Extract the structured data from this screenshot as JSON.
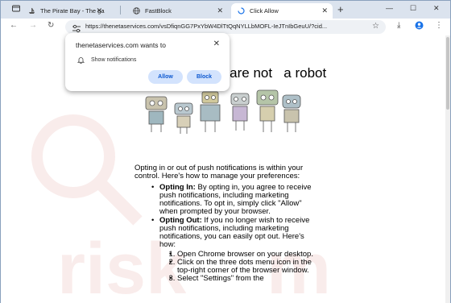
{
  "tabs": [
    {
      "title": "The Pirate Bay - The galaxy's most resilient BitTorrent site",
      "favicon": "pirate-ship-icon"
    },
    {
      "title": "FastBlock",
      "favicon": "globe-icon"
    },
    {
      "title": "Click Allow",
      "favicon": "loading-icon",
      "active": true
    }
  ],
  "toolbar": {
    "url": "https://thenetaservices.com/vsDfiqnGG7PxYbW4DlTtQqNYLLbMOFL-IeJTnIbGeuU/?cid..."
  },
  "popup": {
    "title": "thenetaservices.com wants to",
    "permission": "Show notifications",
    "allow_label": "Allow",
    "block_label": "Block"
  },
  "page": {
    "heading": "u are not   a robot",
    "intro": "Opting in or out of push notifications is within your control. Here's how to manage your preferences:",
    "bullets": [
      {
        "title": "Opting In:",
        "text": " By opting in, you agree to receive push notifications, including marketing notifications. To opt in, simply click \"Allow\" when prompted by your browser."
      },
      {
        "title": "Opting Out:",
        "text": " If you no longer wish to receive push notifications, including marketing notifications, you can easily opt out. Here's how:"
      }
    ],
    "steps": [
      "Open Chrome browser on your desktop.",
      "Click on the three dots menu icon in the top-right corner of the browser window.",
      "Select \"Settings\" from the"
    ]
  },
  "colors": {
    "tabstrip_bg": "#dbe3ee",
    "button_bg": "#d3e3fd",
    "button_text": "#0b57d0"
  }
}
